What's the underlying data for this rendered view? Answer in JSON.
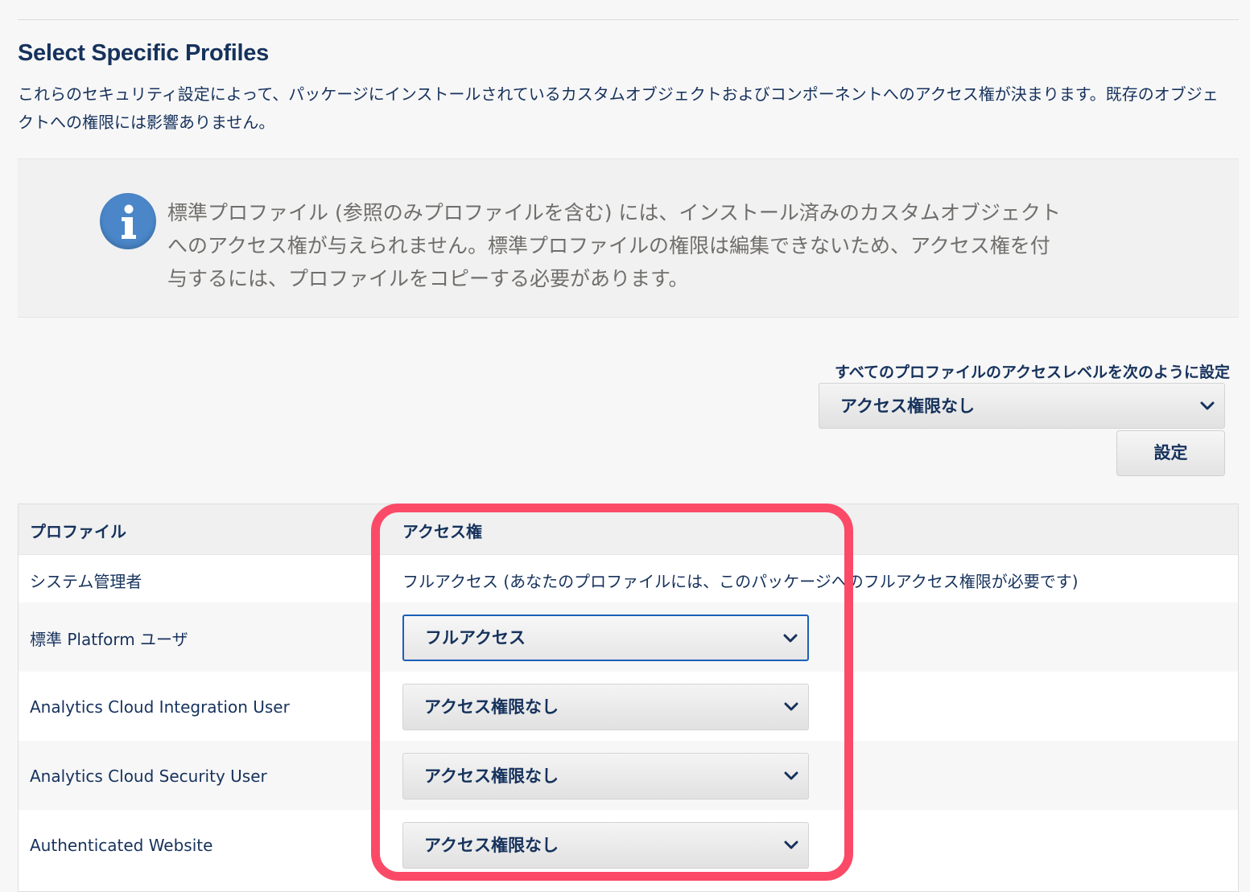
{
  "section": {
    "title": "Select Specific Profiles",
    "description": "これらのセキュリティ設定によって、パッケージにインストールされているカスタムオブジェクトおよびコンポーネントへのアクセス権が決まります。既存のオブジェクトへの権限には影響ありません。"
  },
  "info": {
    "icon": "info-icon",
    "text": "標準プロファイル (参照のみプロファイルを含む) には、インストール済みのカスタムオブジェクトへのアクセス権が与えられません。標準プロファイルの権限は編集できないため、アクセス権を付与するには、プロファイルをコピーする必要があります。"
  },
  "bulk": {
    "label": "すべてのプロファイルのアクセスレベルを次のように設定",
    "selected": "アクセス権限なし",
    "button": "設定"
  },
  "table": {
    "headers": {
      "profile": "プロファイル",
      "access": "アクセス権"
    },
    "rows": [
      {
        "profile": "システム管理者",
        "access": "フルアクセス (あなたのプロファイルには、このパッケージへのフルアクセス権限が必要です)",
        "editable": false
      },
      {
        "profile": "標準 Platform ユーザ",
        "access": "フルアクセス",
        "editable": true
      },
      {
        "profile": "Analytics Cloud Integration User",
        "access": "アクセス権限なし",
        "editable": true
      },
      {
        "profile": "Analytics Cloud Security User",
        "access": "アクセス権限なし",
        "editable": true
      },
      {
        "profile": "Authenticated Website",
        "access": "アクセス権限なし",
        "editable": true
      }
    ]
  },
  "colors": {
    "text_primary": "#16325c",
    "info_text": "#706e6b",
    "info_icon": "#4a86c8",
    "focus_border": "#1b5fb8",
    "highlight": "#fb4a67"
  }
}
